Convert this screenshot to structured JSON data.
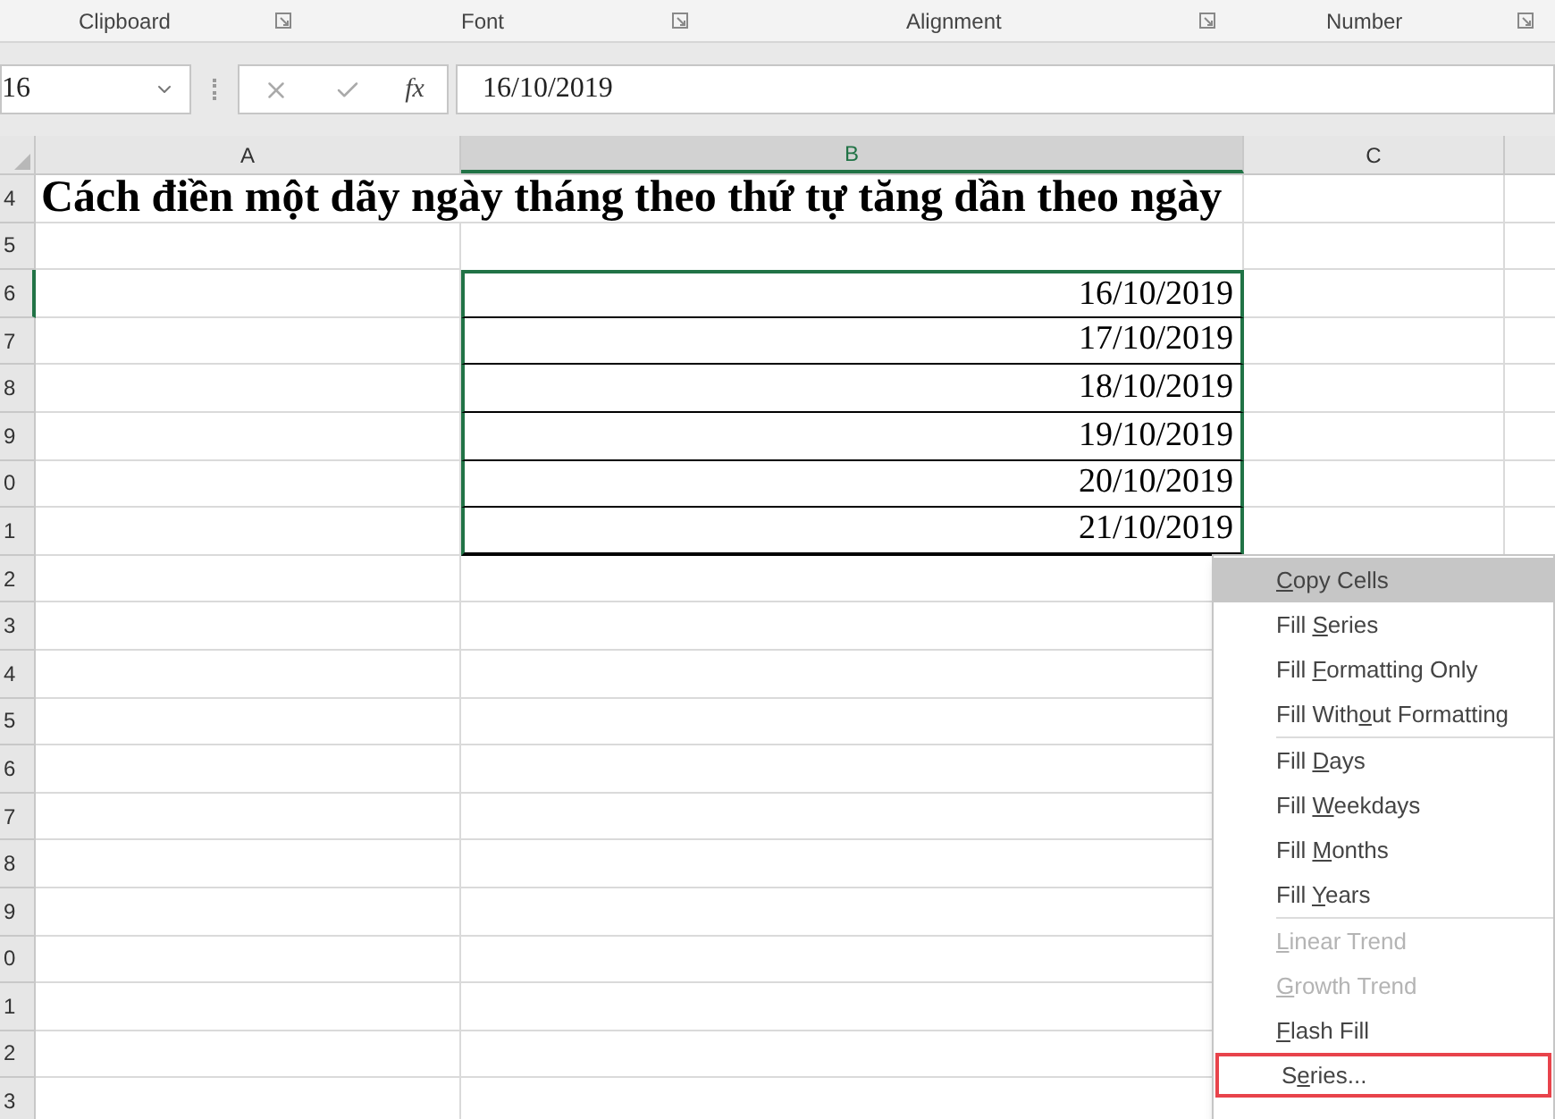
{
  "ribbon_groups": [
    {
      "label": "Clipboard"
    },
    {
      "label": "Font"
    },
    {
      "label": "Alignment"
    },
    {
      "label": "Number"
    }
  ],
  "formula_bar": {
    "name_box": "16",
    "fx": "fx",
    "value": "16/10/2019"
  },
  "columns": [
    {
      "label": "A",
      "selected": false
    },
    {
      "label": "B",
      "selected": true
    },
    {
      "label": "C",
      "selected": false
    }
  ],
  "rows": [
    {
      "header": "4",
      "selected": false,
      "a": "Cách điền một dãy ngày tháng theo thứ tự tăng dần theo ngày"
    },
    {
      "header": "5",
      "selected": false
    },
    {
      "header": "6",
      "selected": true,
      "b": "16/10/2019"
    },
    {
      "header": "7",
      "selected": false,
      "b": "17/10/2019"
    },
    {
      "header": "8",
      "selected": false,
      "b": "18/10/2019"
    },
    {
      "header": "9",
      "selected": false,
      "b": "19/10/2019"
    },
    {
      "header": "0",
      "selected": false,
      "b": "20/10/2019"
    },
    {
      "header": "1",
      "selected": false,
      "b": "21/10/2019"
    },
    {
      "header": "2",
      "selected": false
    },
    {
      "header": "3",
      "selected": false
    },
    {
      "header": "4",
      "selected": false
    },
    {
      "header": "5",
      "selected": false
    },
    {
      "header": "6",
      "selected": false
    },
    {
      "header": "7",
      "selected": false
    },
    {
      "header": "8",
      "selected": false
    },
    {
      "header": "9",
      "selected": false
    },
    {
      "header": "0",
      "selected": false
    },
    {
      "header": "1",
      "selected": false
    },
    {
      "header": "2",
      "selected": false
    },
    {
      "header": "3",
      "selected": false
    }
  ],
  "menu": [
    {
      "key": "C",
      "after": "opy Cells",
      "selected": true,
      "disabled": false,
      "highlighted": false
    },
    {
      "before": "Fill ",
      "key": "S",
      "after": "eries",
      "selected": false,
      "disabled": false,
      "highlighted": false
    },
    {
      "before": "Fill ",
      "key": "F",
      "after": "ormatting Only",
      "selected": false,
      "disabled": false,
      "highlighted": false
    },
    {
      "before": "Fill With",
      "key": "o",
      "after": "ut Formatting",
      "selected": false,
      "disabled": false,
      "highlighted": false,
      "separator_after": true
    },
    {
      "before": "Fill ",
      "key": "D",
      "after": "ays",
      "selected": false,
      "disabled": false,
      "highlighted": false
    },
    {
      "before": "Fill ",
      "key": "W",
      "after": "eekdays",
      "selected": false,
      "disabled": false,
      "highlighted": false
    },
    {
      "before": "Fill ",
      "key": "M",
      "after": "onths",
      "selected": false,
      "disabled": false,
      "highlighted": false
    },
    {
      "before": "Fill ",
      "key": "Y",
      "after": "ears",
      "selected": false,
      "disabled": false,
      "highlighted": false,
      "separator_after": true
    },
    {
      "key": "L",
      "after": "inear Trend",
      "selected": false,
      "disabled": true,
      "highlighted": false
    },
    {
      "key": "G",
      "after": "rowth Trend",
      "selected": false,
      "disabled": true,
      "highlighted": false
    },
    {
      "key": "F",
      "after": "lash Fill",
      "selected": false,
      "disabled": false,
      "highlighted": false
    },
    {
      "before": "S",
      "key": "e",
      "after": "ries...",
      "selected": false,
      "disabled": false,
      "highlighted": true
    }
  ]
}
